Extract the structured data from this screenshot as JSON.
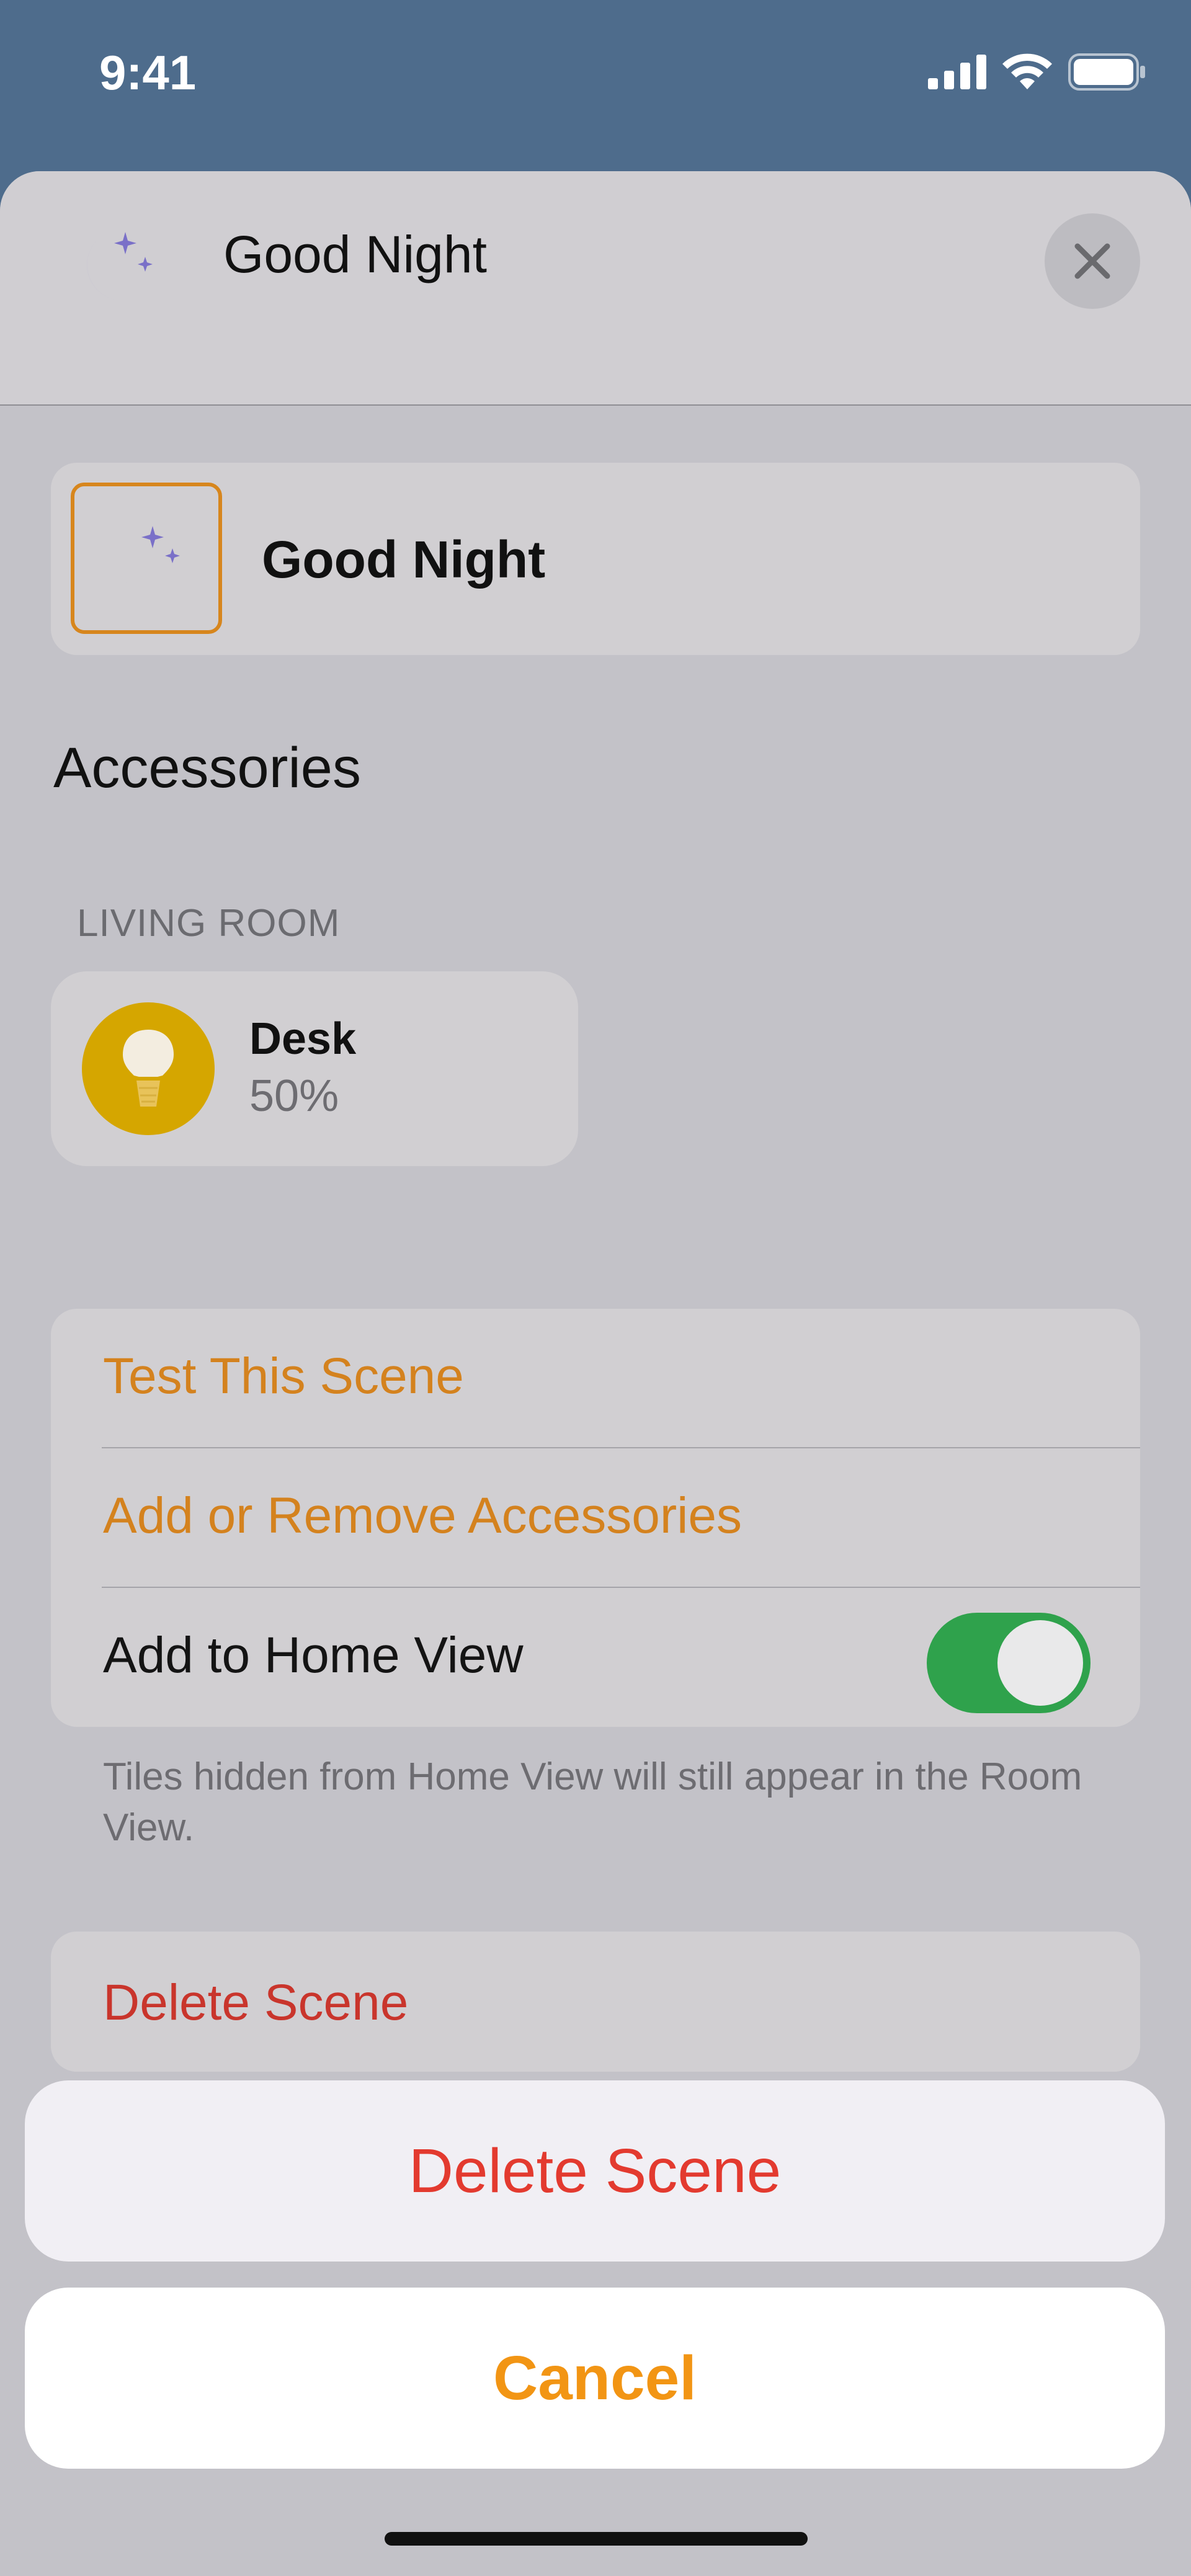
{
  "status_bar": {
    "time": "9:41",
    "icons": [
      "cellular-signal-icon",
      "wifi-icon",
      "battery-icon"
    ]
  },
  "header": {
    "icon": "moon-stars-icon",
    "title": "Good Night",
    "close_icon": "close-icon"
  },
  "scene": {
    "icon": "moon-stars-icon",
    "name": "Good Night"
  },
  "accessories": {
    "title": "Accessories",
    "rooms": [
      {
        "label": "LIVING ROOM",
        "items": [
          {
            "icon": "lightbulb-icon",
            "name": "Desk",
            "value": "50%"
          }
        ]
      }
    ]
  },
  "options": {
    "test_scene": "Test This Scene",
    "add_remove": "Add or Remove Accessories",
    "home_view_label": "Add to Home View",
    "home_view_enabled": true,
    "footer_note": "Tiles hidden from Home View will still appear in the Room View."
  },
  "delete_row": {
    "label": "Delete Scene"
  },
  "action_sheet": {
    "delete_label": "Delete Scene",
    "cancel_label": "Cancel"
  },
  "colors": {
    "accent": "#d4821e",
    "destructive": "#e33a2f",
    "toggle_on": "#2fa24c",
    "moon": "#4c3fb8"
  }
}
